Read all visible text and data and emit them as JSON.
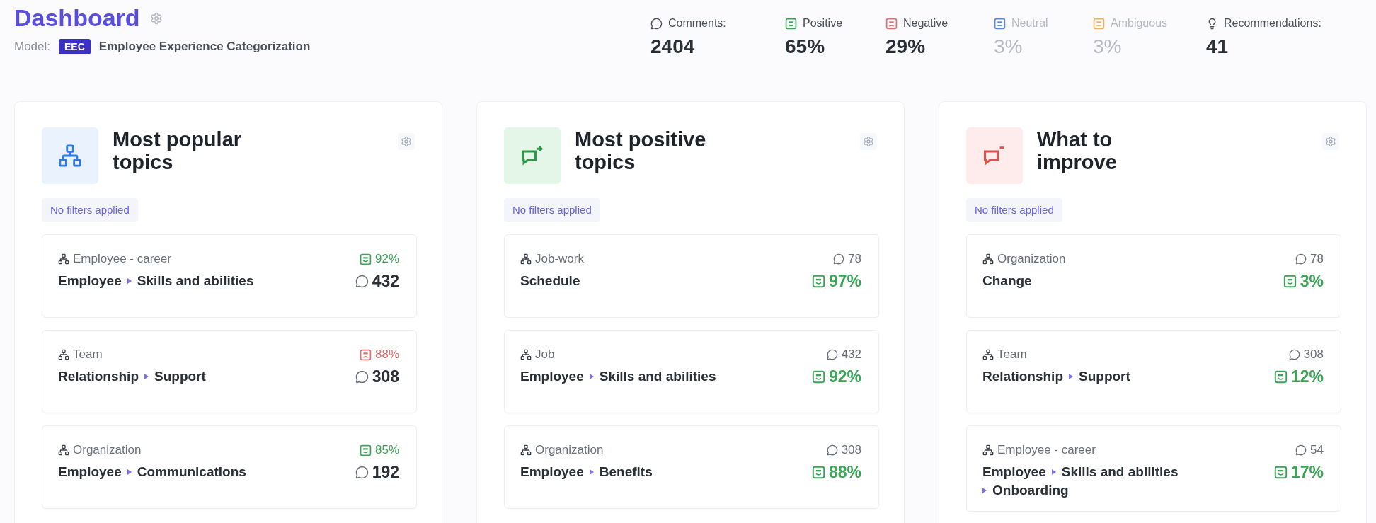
{
  "header": {
    "title": "Dashboard",
    "model_label": "Model:",
    "model_badge": "EEC",
    "model_name": "Employee Experience Categorization"
  },
  "stats": [
    {
      "kind": "comments",
      "label": "Comments:",
      "value": "2404",
      "dimmed": false
    },
    {
      "kind": "positive",
      "label": "Positive",
      "value": "65%",
      "dimmed": false
    },
    {
      "kind": "negative",
      "label": "Negative",
      "value": "29%",
      "dimmed": false
    },
    {
      "kind": "neutral",
      "label": "Neutral",
      "value": "3%",
      "dimmed": true
    },
    {
      "kind": "ambiguous",
      "label": "Ambiguous",
      "value": "3%",
      "dimmed": true
    },
    {
      "kind": "recommendations",
      "label": "Recommendations:",
      "value": "41",
      "dimmed": false
    }
  ],
  "cards": [
    {
      "kind": "popular",
      "title": "Most popular topics",
      "filter": "No filters applied",
      "items": [
        {
          "category": "Employee - career",
          "path": [
            "Employee",
            "Skills and abilities"
          ],
          "sentiment": {
            "kind": "positive",
            "value": "92%"
          },
          "comments": "432"
        },
        {
          "category": "Team",
          "path": [
            "Relationship",
            "Support"
          ],
          "sentiment": {
            "kind": "negative",
            "value": "88%"
          },
          "comments": "308"
        },
        {
          "category": "Organization",
          "path": [
            "Employee",
            "Communications"
          ],
          "sentiment": {
            "kind": "positive",
            "value": "85%"
          },
          "comments": "192"
        }
      ]
    },
    {
      "kind": "positive",
      "title": "Most positive topics",
      "filter": "No filters applied",
      "items": [
        {
          "category": "Job-work",
          "path": [
            "Schedule"
          ],
          "sentiment": {
            "kind": "positive",
            "value": "97%"
          },
          "comments": "78"
        },
        {
          "category": "Job",
          "path": [
            "Employee",
            "Skills and abilities"
          ],
          "sentiment": {
            "kind": "positive",
            "value": "92%"
          },
          "comments": "432"
        },
        {
          "category": "Organization",
          "path": [
            "Employee",
            "Benefits"
          ],
          "sentiment": {
            "kind": "positive",
            "value": "88%"
          },
          "comments": "308"
        }
      ]
    },
    {
      "kind": "improve",
      "title": "What to improve",
      "filter": "No filters applied",
      "items": [
        {
          "category": "Organization",
          "path": [
            "Change"
          ],
          "sentiment": {
            "kind": "positive",
            "value": "3%"
          },
          "comments": "78"
        },
        {
          "category": "Team",
          "path": [
            "Relationship",
            "Support"
          ],
          "sentiment": {
            "kind": "positive",
            "value": "12%"
          },
          "comments": "308"
        },
        {
          "category": "Employee - career",
          "path": [
            "Employee",
            "Skills and abilities",
            "Onboarding"
          ],
          "sentiment": {
            "kind": "positive",
            "value": "17%"
          },
          "comments": "54"
        }
      ]
    }
  ]
}
